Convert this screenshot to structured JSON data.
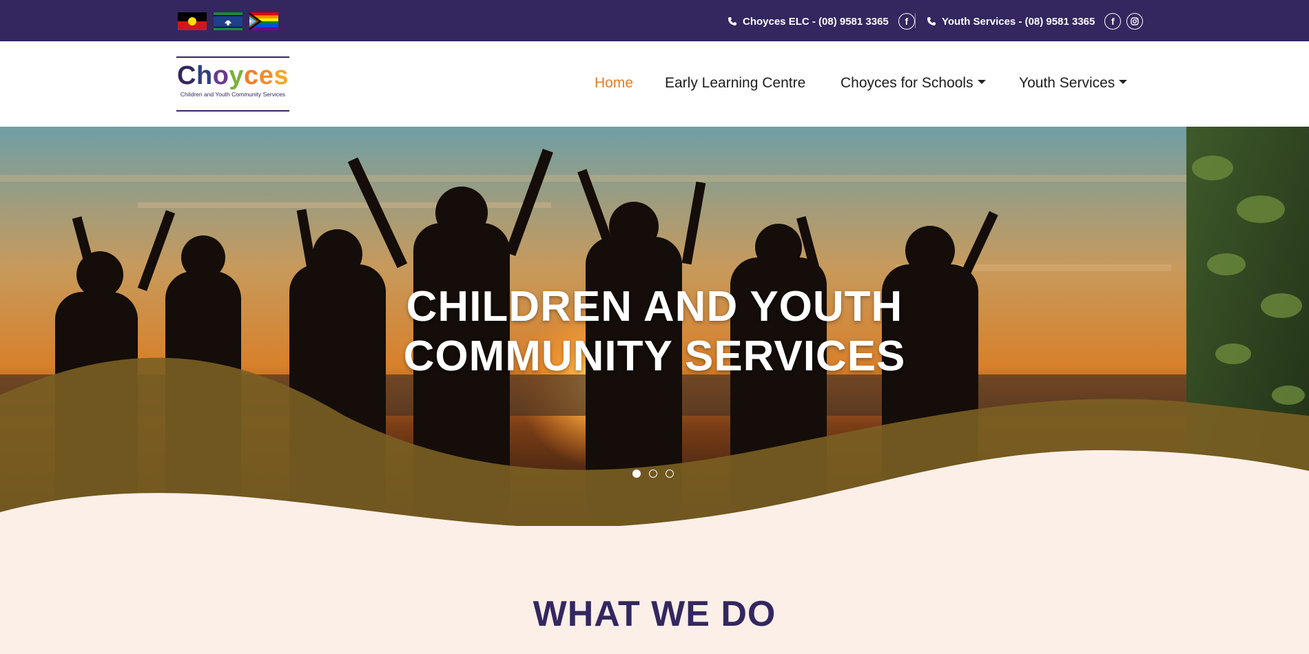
{
  "topbar": {
    "flags": [
      "aboriginal-flag",
      "torres-strait-islander-flag",
      "progress-pride-flag"
    ],
    "contacts": [
      {
        "label": "Choyces ELC - (08) 9581 3365",
        "icons": [
          "facebook-icon"
        ]
      },
      {
        "label": "Youth Services - (08) 9581 3365",
        "icons": [
          "facebook-icon",
          "instagram-icon"
        ]
      }
    ]
  },
  "logo": {
    "word": [
      "C",
      "h",
      "o",
      "y",
      "c",
      "e",
      "s"
    ],
    "colors": [
      "#34275f",
      "#2f3f7d",
      "#6a3a8f",
      "#7bb13b",
      "#f07d2e",
      "#f28c2b",
      "#f5a623"
    ],
    "subtitle": "Children and Youth Community Services"
  },
  "nav": {
    "items": [
      {
        "label": "Home",
        "active": true,
        "dropdown": false
      },
      {
        "label": "Early Learning Centre",
        "active": false,
        "dropdown": false
      },
      {
        "label": "Choyces for Schools",
        "active": false,
        "dropdown": true
      },
      {
        "label": "Youth Services",
        "active": false,
        "dropdown": true
      }
    ]
  },
  "hero": {
    "title_line1": "CHILDREN AND YOUTH",
    "title_line2": "COMMUNITY SERVICES",
    "slides": 3,
    "active_slide": 0
  },
  "section": {
    "title": "WHAT WE DO"
  },
  "colors": {
    "brand_purple": "#34275f",
    "accent_orange": "#e57c24",
    "cream": "#fcefe8",
    "wave_gold": "#7a5f22"
  }
}
